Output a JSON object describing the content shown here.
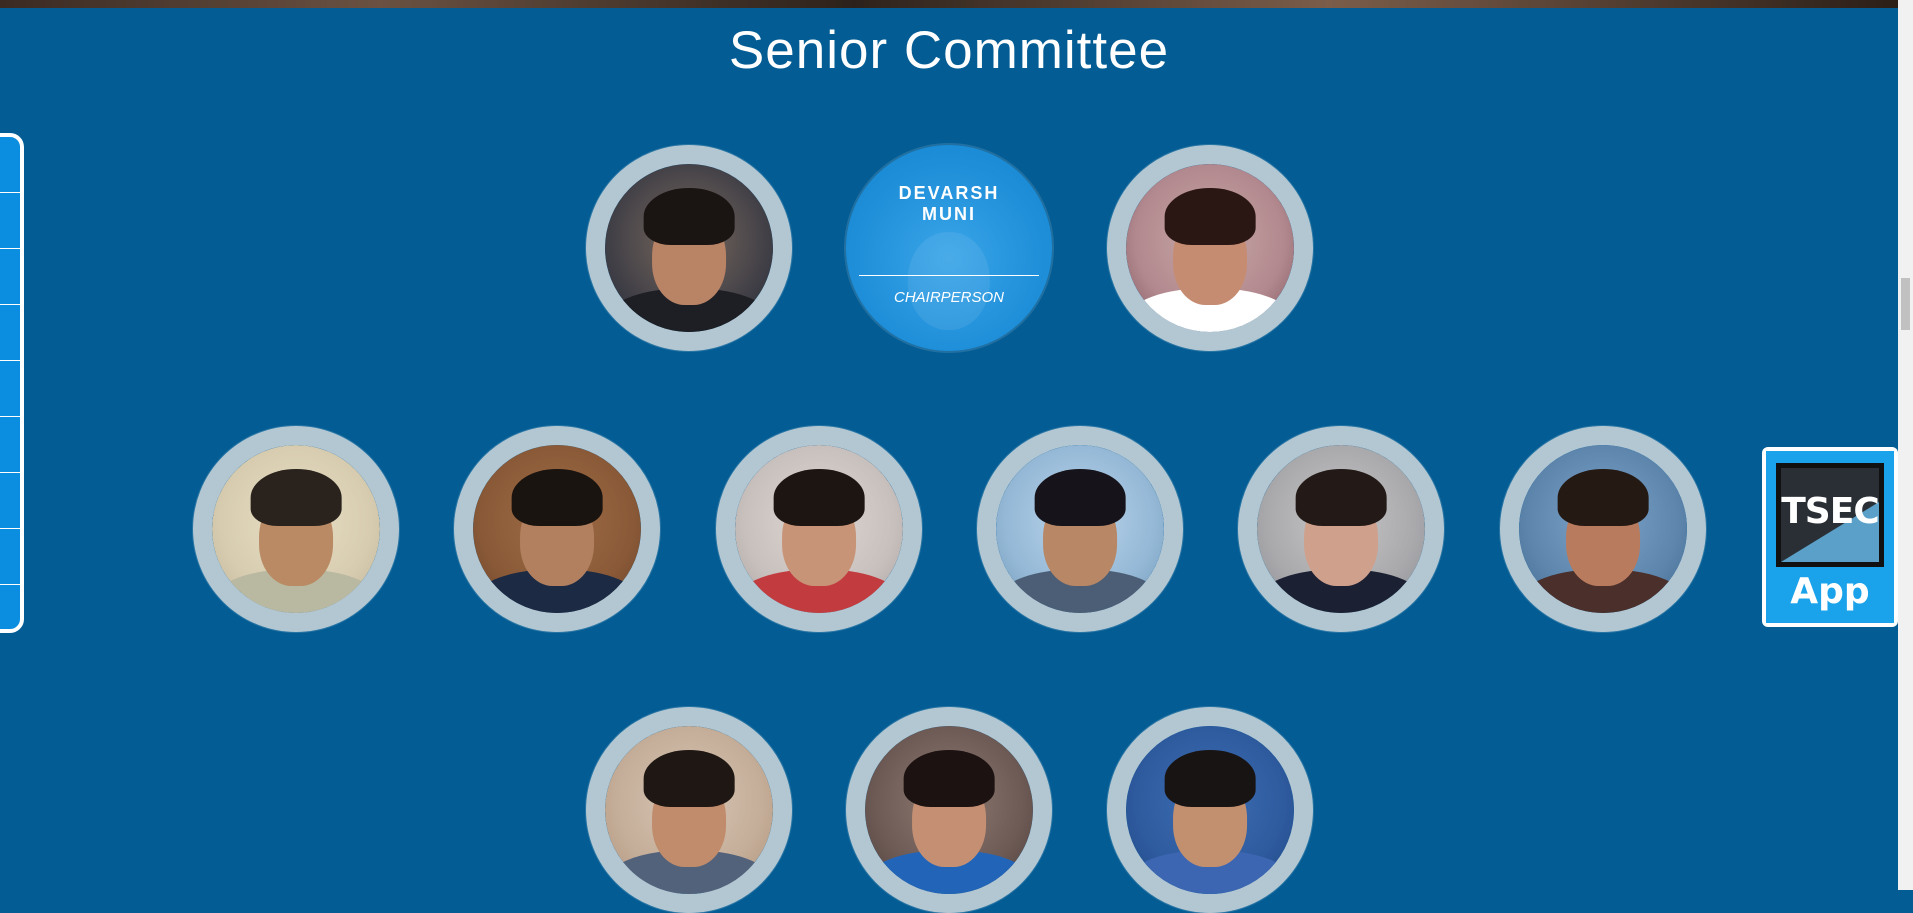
{
  "section": {
    "title": "Senior Committee"
  },
  "featured_member": {
    "name": "DEVARSH\nMUNI",
    "role": "CHAIRPERSON"
  },
  "app_widget": {
    "logo_text": "TSEC",
    "label": "App"
  },
  "colors": {
    "page_background": "#035d94",
    "featured_circle": "#1f8fd9",
    "nav_background": "#0b8ee0",
    "ring": "#e6e6e6"
  },
  "side_nav": {
    "segment_count": 9
  }
}
